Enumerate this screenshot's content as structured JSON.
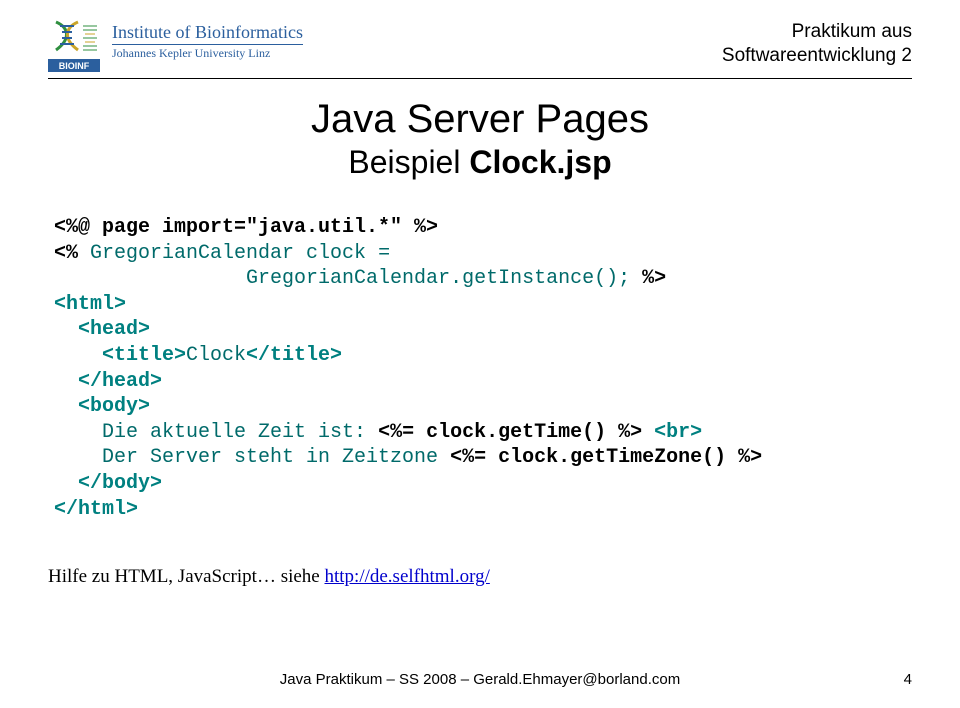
{
  "header": {
    "institute_line1": "Institute of Bioinformatics",
    "institute_line2": "Johannes Kepler University Linz",
    "logo_label": "BIOINF",
    "course_line1": "Praktikum aus",
    "course_line2": "Softwareentwicklung 2"
  },
  "title": {
    "line1": "Java Server Pages",
    "line2_prefix": "Beispiel ",
    "line2_bold": "Clock.jsp"
  },
  "code": {
    "l01": "<%@ page import=\"java.util.*\" %>",
    "l02a": "<% ",
    "l02b": "GregorianCalendar clock =",
    "l03": "                GregorianCalendar.getInstance();",
    "l03b": " %>",
    "l04": "<html>",
    "l05": "  <head>",
    "l06a": "    <title>",
    "l06b": "Clock",
    "l06c": "</title>",
    "l07": "  </head>",
    "l08": "  <body>",
    "l09a": "    Die aktuelle Zeit ist: ",
    "l09b": "<%= clock.getTime() %>",
    "l09c": " <br>",
    "l10a": "    Der Server steht in Zeitzone ",
    "l10b": "<%= clock.getTimeZone() %>",
    "l11": "  </body>",
    "l12": "</html>"
  },
  "hint": {
    "text": "Hilfe zu HTML, JavaScript… siehe ",
    "link_text": "http://de.selfhtml.org/"
  },
  "footer": {
    "text": "Java Praktikum – SS 2008 – Gerald.Ehmayer@borland.com",
    "page": "4"
  }
}
